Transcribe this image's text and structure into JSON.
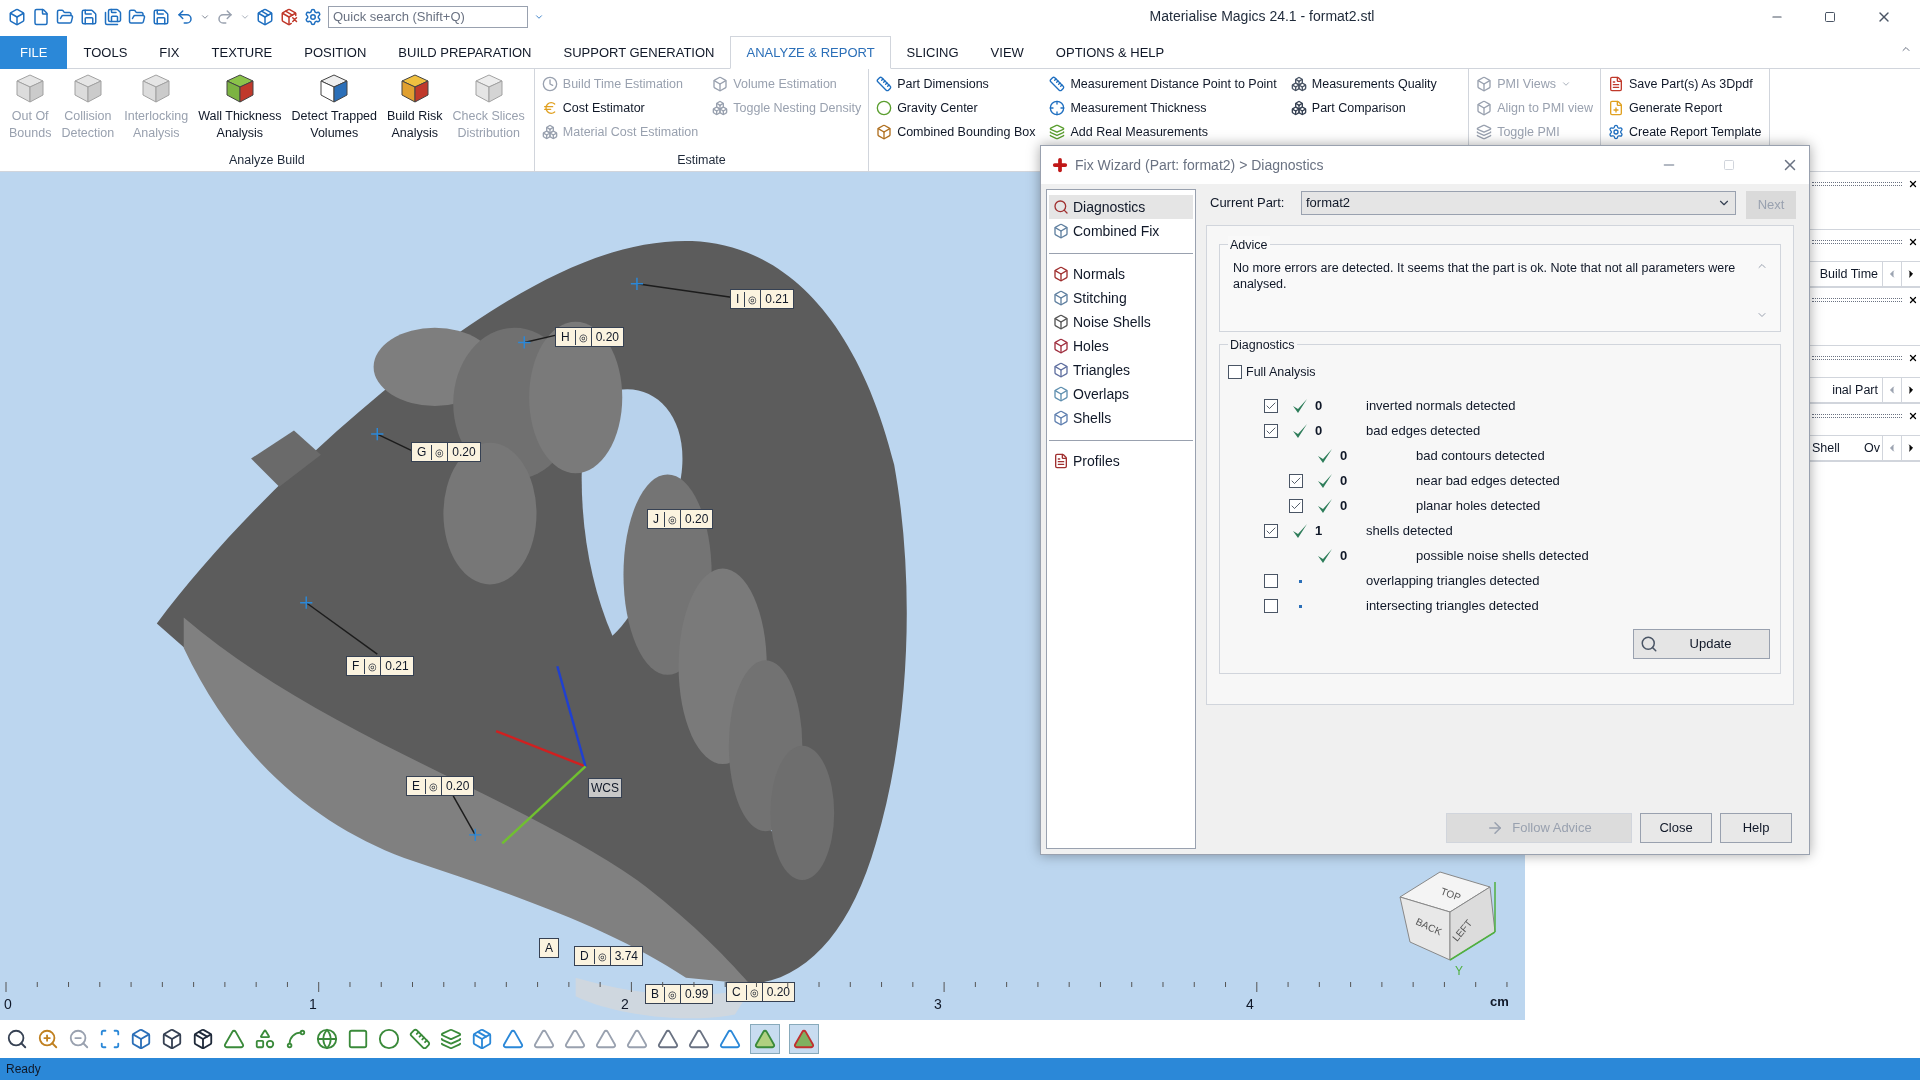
{
  "window": {
    "title": "Materialise Magics 24.1 - format2.stl"
  },
  "search": {
    "placeholder": "Quick search (Shift+Q)"
  },
  "file_menu": "FILE",
  "tabs": [
    {
      "label": "TOOLS",
      "selected": false
    },
    {
      "label": "FIX",
      "selected": false
    },
    {
      "label": "TEXTURE",
      "selected": false
    },
    {
      "label": "POSITION",
      "selected": false
    },
    {
      "label": "BUILD PREPARATION",
      "selected": false
    },
    {
      "label": "SUPPORT GENERATION",
      "selected": false
    },
    {
      "label": "ANALYZE & REPORT",
      "selected": true
    },
    {
      "label": "SLICING",
      "selected": false
    },
    {
      "label": "VIEW",
      "selected": false
    },
    {
      "label": "OPTIONS & HELP",
      "selected": false
    }
  ],
  "ribbon": {
    "groups": [
      {
        "title": "Analyze Build",
        "kind": "large",
        "items": [
          {
            "label": "Out Of\nBounds",
            "disabled": true
          },
          {
            "label": "Collision\nDetection",
            "disabled": true
          },
          {
            "label": "Interlocking\nAnalysis",
            "disabled": true
          },
          {
            "label": "Wall Thickness\nAnalysis",
            "disabled": false
          },
          {
            "label": "Detect Trapped\nVolumes",
            "disabled": false
          },
          {
            "label": "Build Risk\nAnalysis",
            "disabled": false
          },
          {
            "label": "Check Slices\nDistribution",
            "disabled": true
          }
        ]
      },
      {
        "title": "Estimate",
        "kind": "small",
        "items": [
          {
            "label": "Build Time Estimation",
            "disabled": true
          },
          {
            "label": "Cost Estimator",
            "disabled": false
          },
          {
            "label": "Material Cost Estimation",
            "disabled": true
          },
          {
            "label": "Volume Estimation",
            "disabled": true
          },
          {
            "label": "Toggle Nesting Density",
            "disabled": true
          }
        ]
      },
      {
        "kind": "small",
        "items": [
          {
            "label": "Part Dimensions",
            "disabled": false
          },
          {
            "label": "Gravity Center",
            "disabled": false
          },
          {
            "label": "Combined Bounding Box",
            "disabled": false
          },
          {
            "label": "Measurement Distance Point to Point",
            "disabled": false
          },
          {
            "label": "Measurement Thickness",
            "disabled": false
          },
          {
            "label": "Add Real Measurements",
            "disabled": false
          },
          {
            "label": "Measurements Quality",
            "disabled": false
          },
          {
            "label": "Part Comparison",
            "disabled": false
          }
        ]
      },
      {
        "kind": "small",
        "items": [
          {
            "label": "PMI Views",
            "disabled": true,
            "menu": true
          },
          {
            "label": "Align to PMI view",
            "disabled": true,
            "menu": false
          },
          {
            "label": "Toggle PMI",
            "disabled": true,
            "menu": false
          }
        ]
      },
      {
        "kind": "small",
        "items": [
          {
            "label": "Save Part(s) As 3Dpdf",
            "disabled": false
          },
          {
            "label": "Generate Report",
            "disabled": false
          },
          {
            "label": "Create Report Template",
            "disabled": false
          }
        ]
      }
    ]
  },
  "viewport": {
    "tags": [
      {
        "letter": "I",
        "symbol": "◎",
        "value": "0.21"
      },
      {
        "letter": "H",
        "symbol": "◎",
        "value": "0.20"
      },
      {
        "letter": "G",
        "symbol": "◎",
        "value": "0.20"
      },
      {
        "letter": "J",
        "symbol": "◎",
        "value": "0.20"
      },
      {
        "letter": "F",
        "symbol": "◎",
        "value": "0.21"
      },
      {
        "letter": "E",
        "symbol": "◎",
        "value": "0.20"
      },
      {
        "letter": "A"
      },
      {
        "letter": "D",
        "symbol": "◎",
        "value": "3.74"
      },
      {
        "letter": "B",
        "symbol": "◎",
        "value": "0.99"
      },
      {
        "letter": "C",
        "symbol": "◎",
        "value": "0.20"
      }
    ],
    "wcs": "WCS",
    "view_cube": {
      "faces": [
        "TOP",
        "BACK",
        "LEFT"
      ],
      "axis": "Y"
    },
    "ruler": {
      "labels": [
        "0",
        "1",
        "2",
        "3",
        "4"
      ],
      "unit": "cm"
    }
  },
  "side_panels": [
    {
      "closable": true
    },
    {
      "closable": true,
      "labels": [
        "Build Time"
      ]
    },
    {
      "closable": true
    },
    {
      "closable": true,
      "labels": [
        "inal Part"
      ]
    },
    {
      "closable": true,
      "labels": [
        "Shell",
        "Ov"
      ]
    }
  ],
  "dialog": {
    "title": "Fix Wizard (Part: format2) > Diagnostics",
    "nav": [
      {
        "items": [
          {
            "label": "Diagnostics",
            "selected": true
          },
          {
            "label": "Combined Fix",
            "selected": false
          }
        ]
      },
      {
        "items": [
          {
            "label": "Normals",
            "selected": false
          },
          {
            "label": "Stitching",
            "selected": false
          },
          {
            "label": "Noise Shells",
            "selected": false
          },
          {
            "label": "Holes",
            "selected": false
          },
          {
            "label": "Triangles",
            "selected": false
          },
          {
            "label": "Overlaps",
            "selected": false
          },
          {
            "label": "Shells",
            "selected": false
          }
        ]
      },
      {
        "items": [
          {
            "label": "Profiles",
            "selected": false
          }
        ]
      }
    ],
    "current_part": {
      "label": "Current Part:",
      "value": "format2"
    },
    "next_button": {
      "label": "Next",
      "disabled": true
    },
    "advice": {
      "title": "Advice",
      "text": "No more errors are detected. It seems that the part is ok. Note that not all parameters were analysed."
    },
    "diagnostics": {
      "title": "Diagnostics",
      "full_analysis": {
        "label": "Full Analysis",
        "checked": false
      },
      "rows": [
        {
          "kind": "checkbox",
          "checked": true,
          "passed": true,
          "count": "0",
          "label": "inverted normals detected"
        },
        {
          "kind": "checkbox",
          "checked": true,
          "passed": true,
          "count": "0",
          "label": "bad edges detected",
          "children": [
            {
              "kind": "plain",
              "passed": true,
              "count": "0",
              "label": "bad contours detected"
            },
            {
              "kind": "checkbox",
              "checked": true,
              "passed": true,
              "count": "0",
              "label": "near bad edges detected"
            },
            {
              "kind": "checkbox",
              "checked": true,
              "passed": true,
              "count": "0",
              "label": "planar holes detected"
            }
          ]
        },
        {
          "kind": "checkbox",
          "checked": true,
          "passed": true,
          "count": "1",
          "label": "shells detected",
          "children": [
            {
              "kind": "plain",
              "passed": true,
              "count": "0",
              "label": "possible noise shells detected"
            }
          ]
        },
        {
          "kind": "checkbox",
          "checked": false,
          "passed": false,
          "label": "overlapping triangles detected"
        },
        {
          "kind": "checkbox",
          "checked": false,
          "passed": false,
          "label": "intersecting triangles detected"
        }
      ],
      "update_button": "Update"
    },
    "buttons": [
      {
        "label": "Follow Advice",
        "disabled": true
      },
      {
        "label": "Close",
        "disabled": false
      },
      {
        "label": "Help",
        "disabled": false
      }
    ]
  },
  "status_bar": "Ready"
}
